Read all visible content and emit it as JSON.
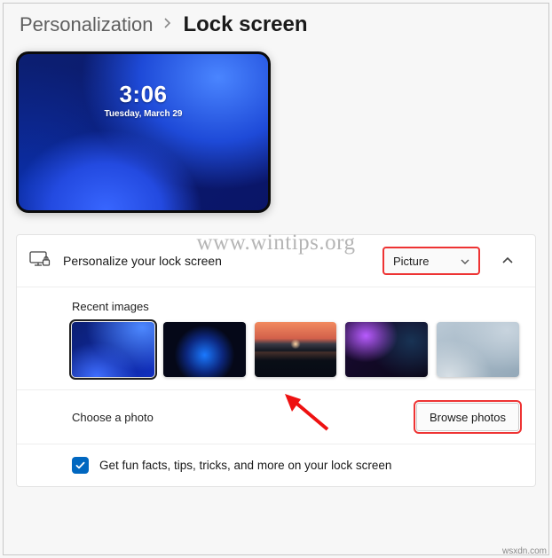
{
  "breadcrumb": {
    "parent": "Personalization",
    "current": "Lock screen"
  },
  "preview": {
    "time": "3:06",
    "date": "Tuesday, March 29"
  },
  "personalize": {
    "label": "Personalize your lock screen",
    "selectValue": "Picture"
  },
  "recent": {
    "label": "Recent images",
    "thumbs": [
      {
        "selected": true,
        "name": "Windows 11 Bloom blue"
      },
      {
        "selected": false,
        "name": "Dark blue glow abstract"
      },
      {
        "selected": false,
        "name": "Sunset horizon over water"
      },
      {
        "selected": false,
        "name": "Purple dark waves abstract"
      },
      {
        "selected": false,
        "name": "Light gray bloom abstract"
      }
    ]
  },
  "choose": {
    "label": "Choose a photo",
    "browse": "Browse photos"
  },
  "funfacts": {
    "checked": true,
    "label": "Get fun facts, tips, tricks, and more on your lock screen"
  },
  "watermark": "www.wintips.org",
  "credit": "wsxdn.com"
}
